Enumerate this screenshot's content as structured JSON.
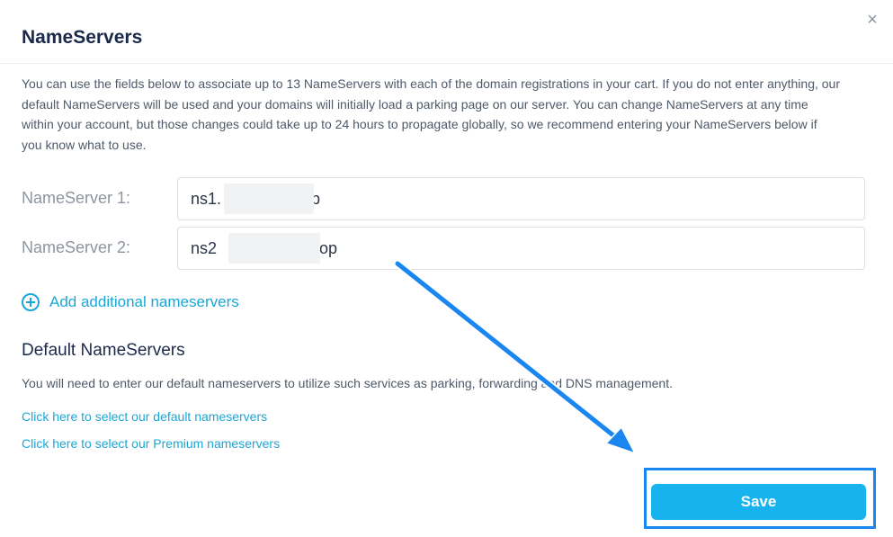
{
  "modal": {
    "title": "NameServers",
    "close_symbol": "×",
    "description": "You can use the fields below to associate up to 13 NameServers with each of the domain registrations in your cart. If you do not enter anything, our default NameServers will be used and your domains will initially load a parking page on our server. You can change NameServers at any time within your account, but those changes could take up to 24 hours to propagate globally, so we recommend entering your NameServers below if you know what to use."
  },
  "nameservers": [
    {
      "label": "NameServer 1:",
      "value": "ns1.                .top"
    },
    {
      "label": "NameServer 2:",
      "value": "ns2                   s.top"
    }
  ],
  "add_additional": {
    "label": "Add additional nameservers",
    "icon": "plus-circle-icon"
  },
  "defaults": {
    "title": "Default NameServers",
    "note": "You will need to enter our default nameservers to utilize such services as parking, forwarding and DNS management.",
    "link_default": "Click here to select our default nameservers",
    "link_premium": "Click here to select our Premium nameservers"
  },
  "actions": {
    "save_label": "Save"
  },
  "colors": {
    "accent": "#1aa7d8",
    "save_bg": "#16b3ee",
    "annotation": "#1a86f0"
  }
}
